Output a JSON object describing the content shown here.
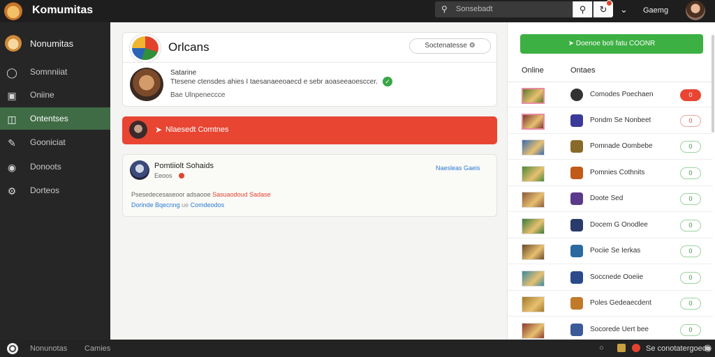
{
  "app": {
    "title": "Komumitas"
  },
  "search": {
    "placeholder": "Sonsebadt"
  },
  "user": {
    "name": "Gaemg"
  },
  "sidebar": {
    "brand": "Nonumitas",
    "items": [
      {
        "label": "Somnniiat",
        "icon": "compass-icon"
      },
      {
        "label": "Oniine",
        "icon": "square-icon"
      },
      {
        "label": "Ontentses",
        "icon": "layout-icon"
      },
      {
        "label": "Gooniciat",
        "icon": "pen-icon"
      },
      {
        "label": "Donoots",
        "icon": "controller-icon"
      },
      {
        "label": "Dorteos",
        "icon": "gear-icon"
      }
    ],
    "active_index": 2
  },
  "main": {
    "header": {
      "title": "Orlcans",
      "button": "Soctenatesse"
    },
    "post": {
      "author": "Satarine",
      "text": "Ttesene ctensdes ahies I taesanaeeoaecd e sebr aoaseeaoesccer.",
      "sub": "Bae Ulnpeneccce"
    },
    "alert": {
      "text": "Nlaesedt Comtnes"
    },
    "comment": {
      "title": "Pomtiiolt Sohaids",
      "sub": "Eeoos",
      "link": "Naesleas Gaeis",
      "line1_grey": "Psesedecesaseoor adsaooe",
      "line1_red": "Sasuaodoud Sadase",
      "line2_blue": "Dorinde Bqecnng",
      "line2_grey": "ue",
      "line2_blue2": "Comdeodos"
    }
  },
  "right_panel": {
    "button": "Doenoe boti fatu COONR",
    "col_online": "Online",
    "col_ontas": "Ontaes",
    "rows": [
      {
        "name": "Comodes Poechaen",
        "badge": "0",
        "badge_style": "red",
        "thumb_color": "#5b7a2c",
        "icon_color": "#333"
      },
      {
        "name": "Pondm Se Nonbeet",
        "badge": "0",
        "badge_style": "pink",
        "thumb_color": "#7a3a2c",
        "icon_color": "#3a3a9a"
      },
      {
        "name": "Pomnade Oombebe",
        "badge": "0",
        "badge_style": "green",
        "thumb_color": "#3a6ab0",
        "icon_color": "#8a6a2a"
      },
      {
        "name": "Pomnies Cothnits",
        "badge": "0",
        "badge_style": "green",
        "thumb_color": "#4a8a3a",
        "icon_color": "#c25a1a"
      },
      {
        "name": "Doote Sed",
        "badge": "0",
        "badge_style": "green",
        "thumb_color": "#8a5a3a",
        "icon_color": "#5a3a8a"
      },
      {
        "name": "Docem G Onodlee",
        "badge": "0",
        "badge_style": "green",
        "thumb_color": "#3a7a3a",
        "icon_color": "#2a3a6a"
      },
      {
        "name": "Pociie Se Ierkas",
        "badge": "0",
        "badge_style": "green",
        "thumb_color": "#6a4a2a",
        "icon_color": "#2a6aa0"
      },
      {
        "name": "Soccnede Ooeiie",
        "badge": "0",
        "badge_style": "green",
        "thumb_color": "#3a8aa0",
        "icon_color": "#2a4a8a"
      },
      {
        "name": "Poles Gedeaecdent",
        "badge": "0",
        "badge_style": "green",
        "thumb_color": "#a07a2a",
        "icon_color": "#c07a2a"
      },
      {
        "name": "Socorede Uert bee",
        "badge": "0",
        "badge_style": "green",
        "thumb_color": "#8a3a2a",
        "icon_color": "#3a5a9a"
      }
    ]
  },
  "bottom": {
    "item1": "Nonunotas",
    "item2": "Camies",
    "status": "Se conotatergoedo"
  }
}
